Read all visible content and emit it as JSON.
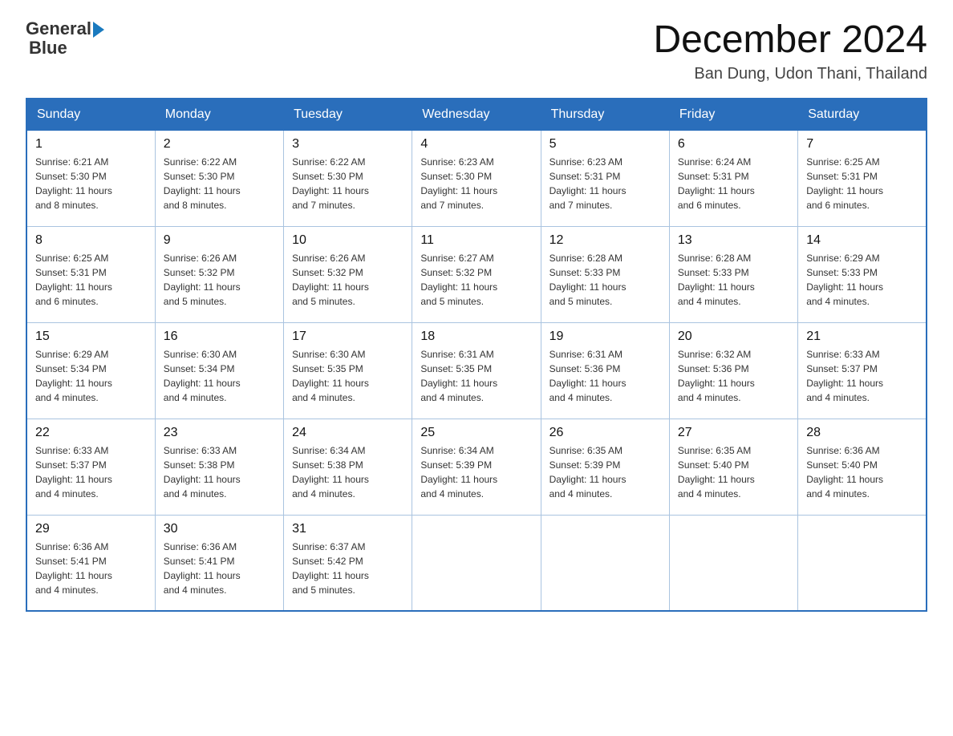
{
  "logo": {
    "text_general": "General",
    "text_blue": "Blue",
    "arrow": "▶"
  },
  "header": {
    "title": "December 2024",
    "subtitle": "Ban Dung, Udon Thani, Thailand"
  },
  "columns": [
    "Sunday",
    "Monday",
    "Tuesday",
    "Wednesday",
    "Thursday",
    "Friday",
    "Saturday"
  ],
  "weeks": [
    [
      {
        "day": "1",
        "sunrise": "6:21 AM",
        "sunset": "5:30 PM",
        "daylight": "11 hours and 8 minutes."
      },
      {
        "day": "2",
        "sunrise": "6:22 AM",
        "sunset": "5:30 PM",
        "daylight": "11 hours and 8 minutes."
      },
      {
        "day": "3",
        "sunrise": "6:22 AM",
        "sunset": "5:30 PM",
        "daylight": "11 hours and 7 minutes."
      },
      {
        "day": "4",
        "sunrise": "6:23 AM",
        "sunset": "5:30 PM",
        "daylight": "11 hours and 7 minutes."
      },
      {
        "day": "5",
        "sunrise": "6:23 AM",
        "sunset": "5:31 PM",
        "daylight": "11 hours and 7 minutes."
      },
      {
        "day": "6",
        "sunrise": "6:24 AM",
        "sunset": "5:31 PM",
        "daylight": "11 hours and 6 minutes."
      },
      {
        "day": "7",
        "sunrise": "6:25 AM",
        "sunset": "5:31 PM",
        "daylight": "11 hours and 6 minutes."
      }
    ],
    [
      {
        "day": "8",
        "sunrise": "6:25 AM",
        "sunset": "5:31 PM",
        "daylight": "11 hours and 6 minutes."
      },
      {
        "day": "9",
        "sunrise": "6:26 AM",
        "sunset": "5:32 PM",
        "daylight": "11 hours and 5 minutes."
      },
      {
        "day": "10",
        "sunrise": "6:26 AM",
        "sunset": "5:32 PM",
        "daylight": "11 hours and 5 minutes."
      },
      {
        "day": "11",
        "sunrise": "6:27 AM",
        "sunset": "5:32 PM",
        "daylight": "11 hours and 5 minutes."
      },
      {
        "day": "12",
        "sunrise": "6:28 AM",
        "sunset": "5:33 PM",
        "daylight": "11 hours and 5 minutes."
      },
      {
        "day": "13",
        "sunrise": "6:28 AM",
        "sunset": "5:33 PM",
        "daylight": "11 hours and 4 minutes."
      },
      {
        "day": "14",
        "sunrise": "6:29 AM",
        "sunset": "5:33 PM",
        "daylight": "11 hours and 4 minutes."
      }
    ],
    [
      {
        "day": "15",
        "sunrise": "6:29 AM",
        "sunset": "5:34 PM",
        "daylight": "11 hours and 4 minutes."
      },
      {
        "day": "16",
        "sunrise": "6:30 AM",
        "sunset": "5:34 PM",
        "daylight": "11 hours and 4 minutes."
      },
      {
        "day": "17",
        "sunrise": "6:30 AM",
        "sunset": "5:35 PM",
        "daylight": "11 hours and 4 minutes."
      },
      {
        "day": "18",
        "sunrise": "6:31 AM",
        "sunset": "5:35 PM",
        "daylight": "11 hours and 4 minutes."
      },
      {
        "day": "19",
        "sunrise": "6:31 AM",
        "sunset": "5:36 PM",
        "daylight": "11 hours and 4 minutes."
      },
      {
        "day": "20",
        "sunrise": "6:32 AM",
        "sunset": "5:36 PM",
        "daylight": "11 hours and 4 minutes."
      },
      {
        "day": "21",
        "sunrise": "6:33 AM",
        "sunset": "5:37 PM",
        "daylight": "11 hours and 4 minutes."
      }
    ],
    [
      {
        "day": "22",
        "sunrise": "6:33 AM",
        "sunset": "5:37 PM",
        "daylight": "11 hours and 4 minutes."
      },
      {
        "day": "23",
        "sunrise": "6:33 AM",
        "sunset": "5:38 PM",
        "daylight": "11 hours and 4 minutes."
      },
      {
        "day": "24",
        "sunrise": "6:34 AM",
        "sunset": "5:38 PM",
        "daylight": "11 hours and 4 minutes."
      },
      {
        "day": "25",
        "sunrise": "6:34 AM",
        "sunset": "5:39 PM",
        "daylight": "11 hours and 4 minutes."
      },
      {
        "day": "26",
        "sunrise": "6:35 AM",
        "sunset": "5:39 PM",
        "daylight": "11 hours and 4 minutes."
      },
      {
        "day": "27",
        "sunrise": "6:35 AM",
        "sunset": "5:40 PM",
        "daylight": "11 hours and 4 minutes."
      },
      {
        "day": "28",
        "sunrise": "6:36 AM",
        "sunset": "5:40 PM",
        "daylight": "11 hours and 4 minutes."
      }
    ],
    [
      {
        "day": "29",
        "sunrise": "6:36 AM",
        "sunset": "5:41 PM",
        "daylight": "11 hours and 4 minutes."
      },
      {
        "day": "30",
        "sunrise": "6:36 AM",
        "sunset": "5:41 PM",
        "daylight": "11 hours and 4 minutes."
      },
      {
        "day": "31",
        "sunrise": "6:37 AM",
        "sunset": "5:42 PM",
        "daylight": "11 hours and 5 minutes."
      },
      null,
      null,
      null,
      null
    ]
  ]
}
